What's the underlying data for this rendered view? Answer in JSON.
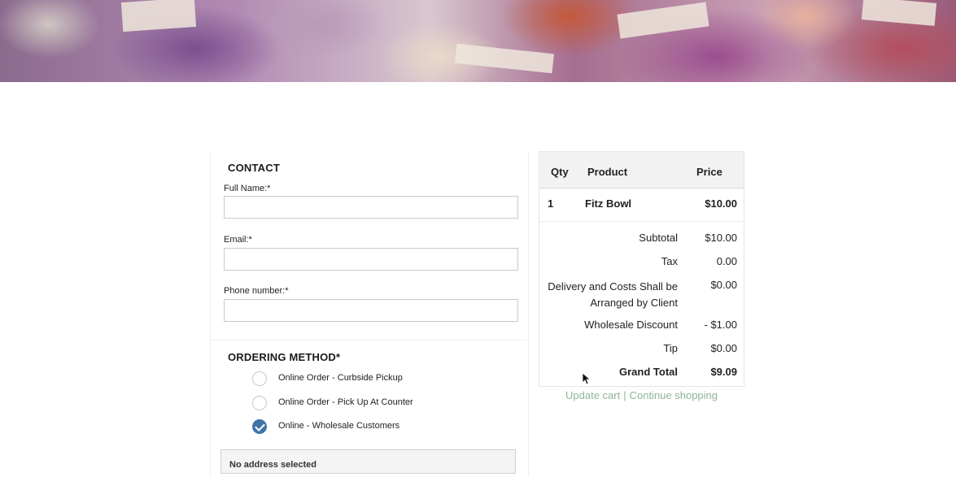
{
  "contact": {
    "title": "CONTACT",
    "full_name": {
      "label": "Full Name:*",
      "value": ""
    },
    "email": {
      "label": "Email:*",
      "value": ""
    },
    "phone": {
      "label": "Phone number:*",
      "value": ""
    }
  },
  "ordering": {
    "title": "ORDERING METHOD*",
    "options": [
      {
        "label": "Online Order - Curbside Pickup",
        "checked": false
      },
      {
        "label": "Online Order - Pick Up At Counter",
        "checked": false
      },
      {
        "label": "Online - Wholesale Customers",
        "checked": true
      }
    ]
  },
  "address": {
    "text": "No address selected"
  },
  "cart": {
    "headers": {
      "qty": "Qty",
      "product": "Product",
      "price": "Price"
    },
    "items": [
      {
        "qty": "1",
        "product": "Fitz Bowl",
        "price": "$10.00"
      }
    ],
    "summary": [
      {
        "label": "Subtotal",
        "value": "$10.00"
      },
      {
        "label": "Tax",
        "value": "0.00"
      },
      {
        "label": "Delivery and Costs Shall be Arranged by Client",
        "value": "$0.00"
      },
      {
        "label": "Wholesale Discount",
        "value": "- $1.00"
      },
      {
        "label": "Tip",
        "value": "$0.00"
      }
    ],
    "grand_total": {
      "label": "Grand Total",
      "value": "$9.09"
    }
  },
  "links": {
    "update_cart": "Update cart",
    "separator": "|",
    "continue_shopping": "Continue shopping"
  }
}
